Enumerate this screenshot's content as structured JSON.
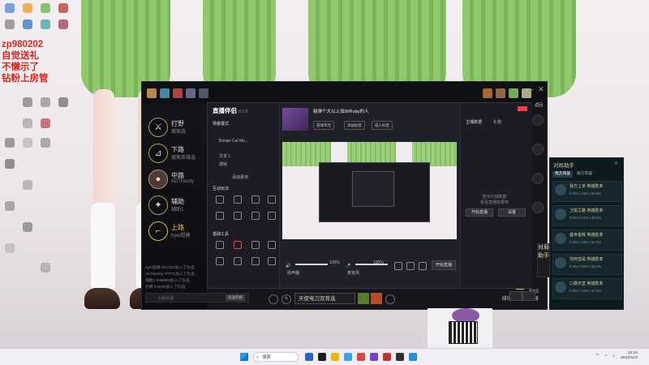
{
  "overlay_notes": [
    "zp980202",
    "自觉送礼",
    "不懒示了",
    "钻粉上房管"
  ],
  "lol_client": {
    "lanes": [
      {
        "title": "打野",
        "sub": "搜索选"
      },
      {
        "title": "下路",
        "sub": "搜索英雄选"
      },
      {
        "title": "中路",
        "sub": "ADTheshy"
      },
      {
        "title": "辅助",
        "sub": "辅助1"
      },
      {
        "title": "上路",
        "sub": "hye/超模"
      }
    ],
    "chat_log": [
      "hye/超模 #5C091加入了队伍",
      "ADTheshy #7071加入了队伍",
      "辅助1 #4B9D9加入了队伍",
      "打野 #AD99加入了队伍"
    ],
    "chat_placeholder": "小组对话",
    "chat_send": "发送到群",
    "mode": "天使电刀双育选",
    "status_1": "SYS",
    "status_2": "排位赛 单排/双排",
    "corner_label": "返回"
  },
  "stream_tool": {
    "logo": "直播伴侣",
    "version": "8.6.8",
    "scene_label": "场景模式",
    "scene_items": [
      "Bongo Cat Mo...",
      "文本 1",
      "游戏"
    ],
    "add_material": "添加素材",
    "tools_title": "互动玩法",
    "tools_title_2": "基础工具",
    "room_title": "秘弹个大以上加99Ruby的人",
    "tags": [
      "游戏单元",
      "添加标签",
      "成人标签"
    ],
    "live_button": "开始直播",
    "audio_label_1": "扬声器",
    "audio_label_2": "麦克风",
    "volume_1": "100%",
    "volume_2": "100%",
    "right_tabs": [
      "主播数据",
      "礼物"
    ],
    "right_hint": "暂无礼物数据\n看看直播效果吧",
    "right_btn_1": "开始直播",
    "right_btn_2": "设置"
  },
  "teammates": {
    "title": "对局助手",
    "tabs": [
      "我方阵容",
      "敌方阵容"
    ],
    "rows": [
      {
        "name": "我方上单 英雄胜率",
        "stat": "0 KDA | 55% | 56.8%"
      },
      {
        "name": "卫冕之路 英雄胜率",
        "stat": "0 KDA | 51% | 49.0%"
      },
      {
        "name": "盛世金辉 英雄胜率",
        "stat": "0 KDA | 48% | 52.3%"
      },
      {
        "name": "怕死但是 英雄胜率",
        "stat": "0 KDA | 50% | 50.1%"
      },
      {
        "name": "口袋天堂 英雄胜率",
        "stat": "0 KDA | 53% | 47.5%"
      }
    ],
    "side_tab": "对局助手"
  },
  "taskbar": {
    "search": "搜索",
    "time": "22:22",
    "date": "2023/11/4"
  },
  "colors": {
    "accent": "#e0201b",
    "gold": "#d6c89a",
    "stream_red": "#ff3b3b"
  }
}
